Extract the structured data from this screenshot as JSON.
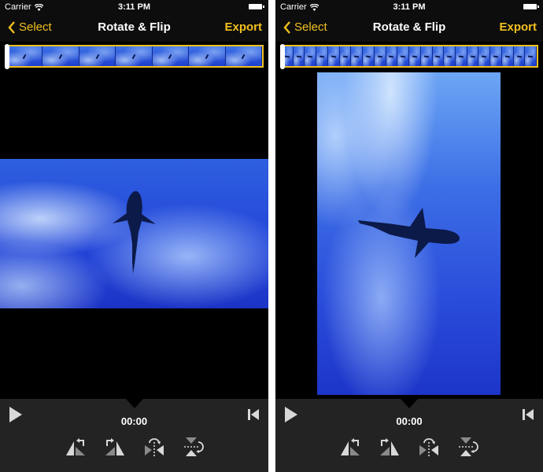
{
  "screens": [
    {
      "id": "left",
      "orientation": "landscape",
      "status": {
        "carrier": "Carrier",
        "time": "3:11 PM"
      },
      "nav": {
        "back_label": "Select",
        "title": "Rotate & Flip",
        "export_label": "Export"
      },
      "timeline": {
        "thumbnail_count": 7,
        "playhead_position": 0
      },
      "playback": {
        "time": "00:00"
      },
      "tools": [
        {
          "name": "rotate-left",
          "icon": "rotate-left-icon"
        },
        {
          "name": "rotate-right",
          "icon": "rotate-right-icon"
        },
        {
          "name": "flip-horizontal",
          "icon": "flip-horizontal-icon"
        },
        {
          "name": "flip-vertical",
          "icon": "flip-vertical-icon"
        }
      ]
    },
    {
      "id": "right",
      "orientation": "portrait",
      "status": {
        "carrier": "Carrier",
        "time": "3:11 PM"
      },
      "nav": {
        "back_label": "Select",
        "title": "Rotate & Flip",
        "export_label": "Export"
      },
      "timeline": {
        "thumbnail_count": 22,
        "playhead_position": 0
      },
      "playback": {
        "time": "00:00"
      },
      "tools": [
        {
          "name": "rotate-left",
          "icon": "rotate-left-icon"
        },
        {
          "name": "rotate-right",
          "icon": "rotate-right-icon"
        },
        {
          "name": "flip-horizontal",
          "icon": "flip-horizontal-icon"
        },
        {
          "name": "flip-vertical",
          "icon": "flip-vertical-icon"
        }
      ]
    }
  ],
  "colors": {
    "accent": "#f2c01e",
    "background": "#000000",
    "toolbar": "#232323",
    "icon": "#d8d8d8"
  }
}
